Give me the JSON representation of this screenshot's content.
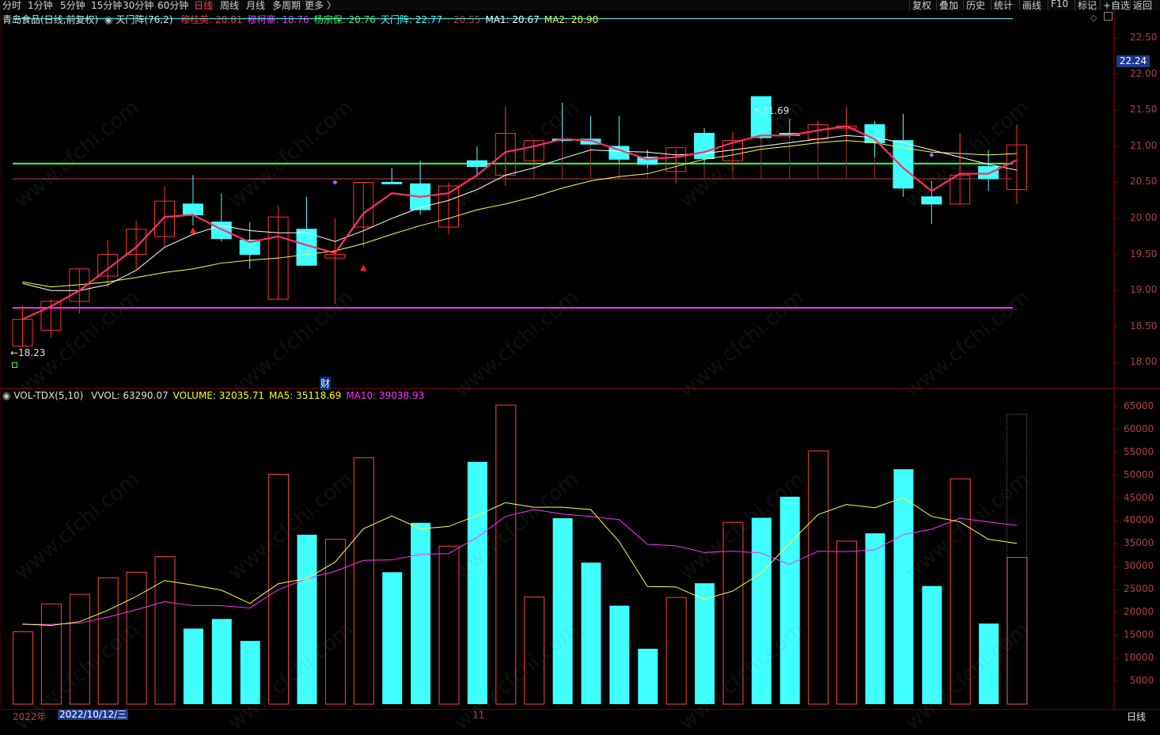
{
  "toolbar": {
    "left": [
      {
        "label": "分时",
        "active": false
      },
      {
        "label": "1分钟",
        "active": false
      },
      {
        "label": "5分钟",
        "active": false
      },
      {
        "label": "15分钟",
        "active": false
      },
      {
        "label": "30分钟",
        "active": false
      },
      {
        "label": "60分钟",
        "active": false
      },
      {
        "label": "日线",
        "active": true
      },
      {
        "label": "周线",
        "active": false
      },
      {
        "label": "月线",
        "active": false
      },
      {
        "label": "多周期",
        "active": false
      },
      {
        "label": "更多 〉",
        "active": false
      }
    ],
    "right": [
      "复权",
      "叠加",
      "历史",
      "统计",
      "画线",
      "F10",
      "标记",
      "+自选",
      "返回"
    ]
  },
  "price_legend": {
    "stock": "青岛食品(日线,前复权)",
    "indicator": "天门阵(76,2)",
    "items": [
      {
        "label": "穆桂英: 20.81",
        "color": "#ff3030"
      },
      {
        "label": "穆柯寨: 18.76",
        "color": "#ff30ff"
      },
      {
        "label": "杨宗保: 20.76",
        "color": "#40ff40"
      },
      {
        "label": "天门阵: 22.77",
        "color": "#40ffff"
      },
      {
        "label": ": 20.55",
        "color": "#c04040"
      },
      {
        "label": "MA1: 20.67",
        "color": "#ffffff"
      },
      {
        "label": "MA2: 20.90",
        "color": "#ffff00"
      }
    ]
  },
  "vol_legend": {
    "name": "VOL-TDX(5,10)",
    "items": [
      {
        "label": "VVOL: 63290.07",
        "color": "#e0e0e0"
      },
      {
        "label": "VOLUME: 32035.71",
        "color": "#ffff00"
      },
      {
        "label": "MA5: 35118.69",
        "color": "#ffff00"
      },
      {
        "label": "MA10: 39038.93",
        "color": "#ff30ff"
      }
    ]
  },
  "price_axis": {
    "ticks": [
      "22.50",
      "22.00",
      "21.50",
      "21.00",
      "20.50",
      "20.00",
      "19.50",
      "19.00",
      "18.50",
      "18.00"
    ],
    "current": "22.24"
  },
  "vol_axis": {
    "ticks": [
      "65000",
      "60000",
      "55000",
      "50000",
      "45000",
      "40000",
      "35000",
      "30000",
      "25000",
      "20000",
      "15000",
      "10000",
      "5000"
    ]
  },
  "annotations": {
    "high": "21.69",
    "low": "←18.23",
    "fin": "财"
  },
  "bottom": {
    "year": "2022年",
    "date": "2022/10/12/三",
    "month": "11",
    "period": "日线"
  },
  "watermark": "www.cfchi.com",
  "chart_data": [
    {
      "type": "candlestick",
      "ylim": [
        17.85,
        22.7
      ],
      "levels": {
        "tianmenzhen": 22.77,
        "yangzongbao": 20.76,
        "mukezhai": 18.76,
        "base": 20.55
      },
      "candles": [
        {
          "o": 18.23,
          "h": 18.79,
          "l": 18.23,
          "c": 18.6,
          "up": true
        },
        {
          "o": 18.45,
          "h": 18.88,
          "l": 18.35,
          "c": 18.85,
          "up": true
        },
        {
          "o": 18.85,
          "h": 19.3,
          "l": 18.68,
          "c": 19.3,
          "up": true
        },
        {
          "o": 19.2,
          "h": 19.7,
          "l": 19.05,
          "c": 19.5,
          "up": true
        },
        {
          "o": 19.5,
          "h": 19.97,
          "l": 19.3,
          "c": 19.85,
          "up": true
        },
        {
          "o": 19.75,
          "h": 20.45,
          "l": 19.6,
          "c": 20.24,
          "up": true
        },
        {
          "o": 20.2,
          "h": 20.6,
          "l": 19.9,
          "c": 20.05,
          "up": false
        },
        {
          "o": 19.95,
          "h": 20.35,
          "l": 19.68,
          "c": 19.72,
          "up": false
        },
        {
          "o": 19.7,
          "h": 19.95,
          "l": 19.3,
          "c": 19.5,
          "up": false
        },
        {
          "o": 18.88,
          "h": 20.18,
          "l": 18.88,
          "c": 20.02,
          "up": true
        },
        {
          "o": 19.85,
          "h": 20.3,
          "l": 19.35,
          "c": 19.35,
          "up": false
        },
        {
          "o": 19.45,
          "h": 20.0,
          "l": 18.82,
          "c": 19.5,
          "up": true
        },
        {
          "o": 19.88,
          "h": 20.5,
          "l": 19.6,
          "c": 20.5,
          "up": true
        },
        {
          "o": 20.5,
          "h": 20.7,
          "l": 20.48,
          "c": 20.48,
          "up": false
        },
        {
          "o": 20.48,
          "h": 20.8,
          "l": 20.05,
          "c": 20.12,
          "up": false
        },
        {
          "o": 19.88,
          "h": 20.5,
          "l": 19.78,
          "c": 20.45,
          "up": true
        },
        {
          "o": 20.8,
          "h": 21.0,
          "l": 20.6,
          "c": 20.72,
          "up": false
        },
        {
          "o": 20.6,
          "h": 21.55,
          "l": 20.45,
          "c": 21.18,
          "up": true
        },
        {
          "o": 20.8,
          "h": 21.08,
          "l": 20.68,
          "c": 21.08,
          "up": true
        },
        {
          "o": 21.1,
          "h": 21.6,
          "l": 21.05,
          "c": 21.08,
          "up": false
        },
        {
          "o": 21.1,
          "h": 21.42,
          "l": 21.02,
          "c": 21.03,
          "up": false
        },
        {
          "o": 21.0,
          "h": 21.42,
          "l": 20.75,
          "c": 20.82,
          "up": false
        },
        {
          "o": 20.85,
          "h": 20.95,
          "l": 20.7,
          "c": 20.75,
          "up": false
        },
        {
          "o": 20.65,
          "h": 20.95,
          "l": 20.48,
          "c": 20.98,
          "up": true
        },
        {
          "o": 21.18,
          "h": 21.25,
          "l": 20.75,
          "c": 20.83,
          "up": false
        },
        {
          "o": 20.8,
          "h": 21.2,
          "l": 20.65,
          "c": 21.08,
          "up": true
        },
        {
          "o": 21.69,
          "h": 21.69,
          "l": 21.1,
          "c": 21.12,
          "up": false
        },
        {
          "o": 21.18,
          "h": 21.38,
          "l": 21.12,
          "c": 21.15,
          "up": false
        },
        {
          "o": 21.1,
          "h": 21.35,
          "l": 21.0,
          "c": 21.3,
          "up": true
        },
        {
          "o": 21.25,
          "h": 21.55,
          "l": 21.1,
          "c": 21.28,
          "up": true
        },
        {
          "o": 21.3,
          "h": 21.35,
          "l": 20.85,
          "c": 21.05,
          "up": false
        },
        {
          "o": 21.08,
          "h": 21.45,
          "l": 20.3,
          "c": 20.42,
          "up": false
        },
        {
          "o": 20.3,
          "h": 20.52,
          "l": 19.92,
          "c": 20.2,
          "up": false
        },
        {
          "o": 20.2,
          "h": 21.18,
          "l": 20.2,
          "c": 20.6,
          "up": true
        },
        {
          "o": 20.72,
          "h": 20.95,
          "l": 20.38,
          "c": 20.55,
          "up": false
        },
        {
          "o": 20.4,
          "h": 21.3,
          "l": 20.2,
          "c": 21.02,
          "up": true
        }
      ],
      "mgy": [
        18.6,
        18.78,
        19.0,
        19.3,
        19.6,
        20.02,
        20.05,
        19.85,
        19.67,
        19.75,
        19.63,
        19.52,
        20.07,
        20.35,
        20.3,
        20.35,
        20.6,
        20.92,
        21.0,
        21.1,
        21.08,
        20.95,
        20.82,
        20.85,
        20.92,
        21.05,
        21.15,
        21.15,
        21.22,
        21.28,
        21.1,
        20.7,
        20.38,
        20.62,
        20.62,
        20.81
      ],
      "ma1": [
        19.1,
        19.0,
        19.0,
        19.08,
        19.28,
        19.6,
        19.78,
        19.9,
        19.83,
        19.8,
        19.8,
        19.68,
        19.83,
        20.0,
        20.15,
        20.25,
        20.4,
        20.6,
        20.7,
        20.83,
        20.95,
        20.93,
        20.92,
        20.88,
        20.9,
        20.95,
        21.0,
        21.05,
        21.1,
        21.15,
        21.12,
        21.05,
        20.95,
        20.85,
        20.75,
        20.67
      ],
      "ma2": [
        19.12,
        19.05,
        19.08,
        19.12,
        19.18,
        19.25,
        19.3,
        19.38,
        19.42,
        19.45,
        19.5,
        19.55,
        19.65,
        19.78,
        19.9,
        20.0,
        20.12,
        20.2,
        20.3,
        20.42,
        20.52,
        20.58,
        20.62,
        20.72,
        20.82,
        20.88,
        20.96,
        21.0,
        21.05,
        21.08,
        21.05,
        20.98,
        20.92,
        20.9,
        20.88,
        20.9
      ],
      "markers": {
        "red_triangle_idx": [
          6,
          12
        ],
        "purple_diamond_idx": [
          11,
          32
        ]
      }
    },
    {
      "type": "bar",
      "ylim": [
        0,
        66000
      ],
      "volume": [
        15800,
        21900,
        24000,
        27600,
        28800,
        32200,
        16500,
        18600,
        13800,
        50200,
        37000,
        36000,
        53800,
        28800,
        39600,
        34500,
        52900,
        65300,
        23400,
        40600,
        30900,
        21500,
        12100,
        23300,
        26400,
        39700,
        40700,
        45300,
        55300,
        35600,
        37300,
        51300,
        25800,
        49200,
        17600,
        32035
      ],
      "up": [
        true,
        true,
        true,
        true,
        true,
        true,
        false,
        false,
        false,
        true,
        false,
        true,
        true,
        false,
        false,
        true,
        false,
        true,
        true,
        false,
        false,
        false,
        false,
        true,
        false,
        true,
        false,
        false,
        true,
        true,
        false,
        false,
        false,
        true,
        false,
        true
      ],
      "ma5": [
        17500,
        17200,
        18000,
        20500,
        23500,
        27000,
        26000,
        24900,
        22000,
        26300,
        27400,
        31000,
        38300,
        41100,
        38300,
        38800,
        41200,
        44000,
        43000,
        43000,
        42500,
        35500,
        25700,
        25600,
        22900,
        24700,
        28600,
        35100,
        41400,
        43600,
        42900,
        45100,
        41000,
        39800,
        36000,
        35119
      ],
      "ma10": [
        17400,
        17400,
        17700,
        19000,
        20600,
        22400,
        21500,
        21500,
        21000,
        25000,
        27400,
        29000,
        31400,
        31500,
        32700,
        32900,
        36400,
        41000,
        42500,
        41500,
        41000,
        40300,
        34900,
        34600,
        33100,
        33400,
        33000,
        30500,
        33400,
        33300,
        33700,
        37000,
        38200,
        40600,
        39800,
        39039
      ],
      "vvol_last": 63290.07
    }
  ]
}
